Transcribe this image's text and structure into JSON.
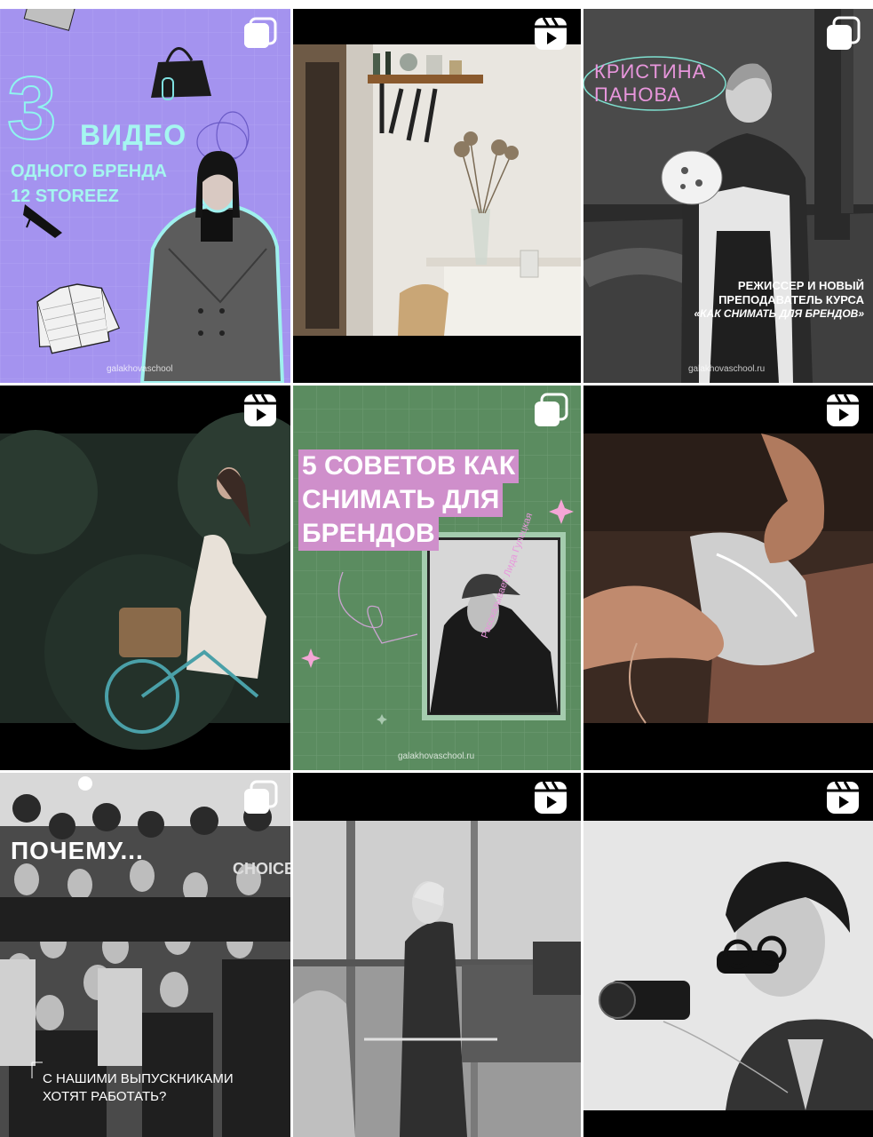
{
  "posts": [
    {
      "type": "carousel",
      "big_number": "3",
      "headline": "ВИДЕО",
      "subline1": "ОДНОГО БРЕНДА",
      "subline2": "12 STOREEZ",
      "url": "galakhovaschool"
    },
    {
      "type": "reel"
    },
    {
      "type": "carousel",
      "name_line1": "КРИСТИНА",
      "name_line2": "ПАНОВА",
      "desc1": "РЕЖИССЕР И НОВЫЙ",
      "desc2": "ПРЕПОДАВАТЕЛЬ КУРСА",
      "desc3": "«КАК СНИМАТЬ ДЛЯ БРЕНДОВ»",
      "url": "galakhovaschool.ru"
    },
    {
      "type": "reel"
    },
    {
      "type": "carousel",
      "line1": "5 СОВЕТОВ КАК",
      "line2": "СНИМАТЬ ДЛЯ",
      "line3": "БРЕНДОВ",
      "vertical": "Рассказывает Лида Гулецкая",
      "url": "galakhovaschool.ru"
    },
    {
      "type": "reel"
    },
    {
      "type": "carousel",
      "headline": "ПОЧЕМУ...",
      "bottom1": "С НАШИМИ ВЫПУСКНИКАМИ",
      "bottom2": "ХОТЯТ РАБОТАТЬ?",
      "shirt": "CHOICE"
    },
    {
      "type": "reel"
    },
    {
      "type": "reel"
    }
  ]
}
